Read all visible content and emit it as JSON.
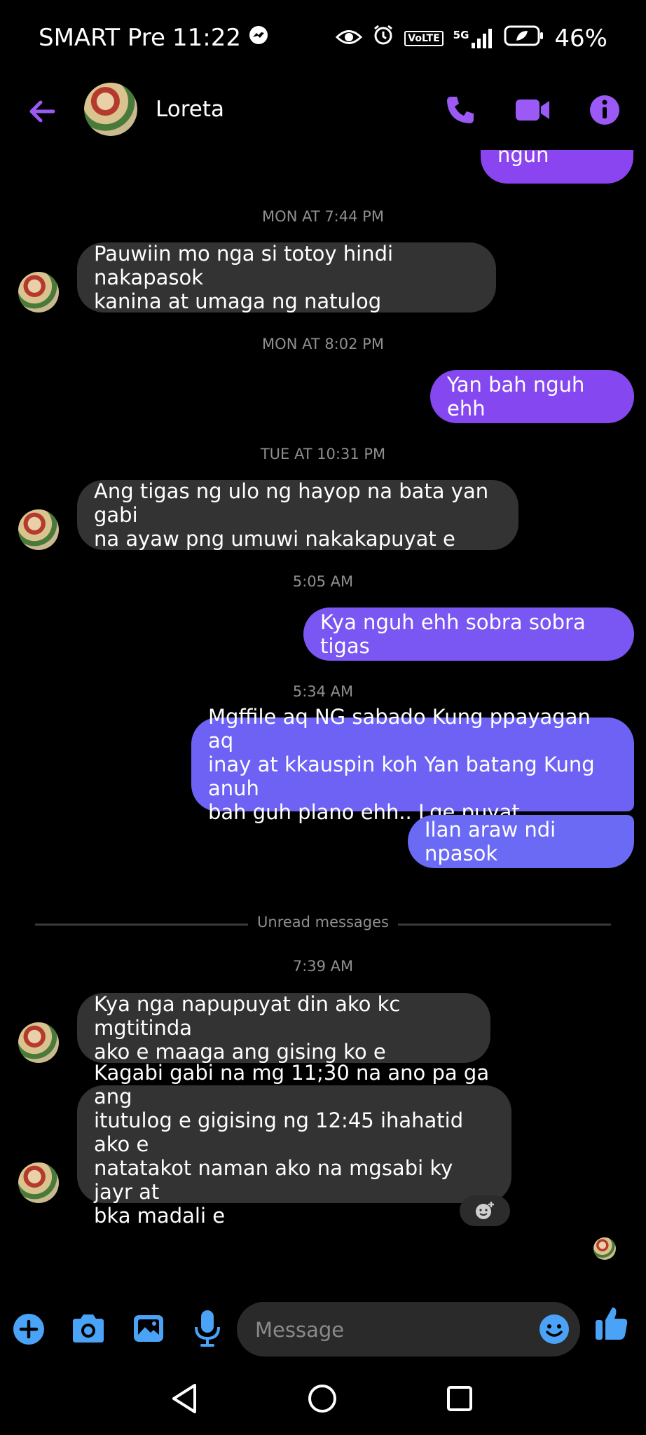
{
  "status_bar": {
    "carrier": "SMART Pre",
    "time": "11:22",
    "volte": "VoLTE",
    "network": "5G",
    "battery": "46%"
  },
  "header": {
    "contact_name": "Loreta"
  },
  "messages": {
    "partial_top": "Oh kya ngun",
    "ts1": "MON AT 7:44 PM",
    "m1_line1": "Pauwiin mo nga si totoy hindi nakapasok",
    "m1_line2": "kanina at umaga ng natulog",
    "ts2": "MON AT 8:02 PM",
    "m2": "Yan bah nguh ehh",
    "ts3": "TUE AT 10:31 PM",
    "m3_line1": "Ang tigas ng ulo ng hayop na bata yan gabi",
    "m3_line2": "na ayaw png umuwi nakakapuyat e",
    "ts4": "5:05 AM",
    "m4": "Kya nguh ehh sobra sobra tigas",
    "ts5": "5:34 AM",
    "m5_line1": "Mgffile aq NG sabado Kung ppayagan aq",
    "m5_line2": "inay at kkauspin koh Yan batang Kung anuh",
    "m5_line3": "bah guh plano ehh.. Lge puyat",
    "m6": "Ilan araw ndi npasok",
    "unread_label": "Unread messages",
    "ts6": "7:39 AM",
    "m7_line1": "Kya nga napupuyat din ako kc mgtitinda",
    "m7_line2": "ako e maaga ang gising ko e",
    "m8_line1": "Kagabi gabi na mg 11;30 na ano pa ga ang",
    "m8_line2": "itutulog e gigising ng 12:45 ihahatid ako e",
    "m8_line3": "natatakot naman ako na mgsabi ky jayr at",
    "m8_line4": "bka madali e"
  },
  "composer": {
    "placeholder": "Message"
  },
  "colors": {
    "accent_purple": "#9b59f5",
    "outgoing_top": "#8b45f0",
    "outgoing_bottom": "#6c6cf5",
    "incoming": "#333333",
    "composer_blue": "#4aa3f7"
  },
  "icons": {
    "back": "arrow-left-icon",
    "call": "phone-icon",
    "video": "video-icon",
    "info": "info-icon",
    "add": "plus-icon",
    "camera": "camera-icon",
    "gallery": "image-icon",
    "mic": "microphone-icon",
    "emoji": "emoji-icon",
    "like": "thumbs-up-icon",
    "react": "add-reaction-icon"
  }
}
